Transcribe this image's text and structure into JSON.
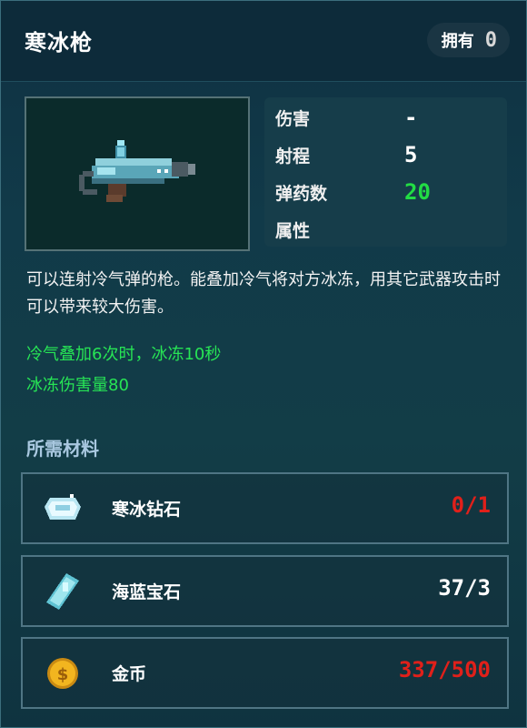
{
  "header": {
    "title": "寒冰枪",
    "owned_label": "拥有",
    "owned_count": "0"
  },
  "weapon": {
    "icon": "ice-gun-icon"
  },
  "stats": {
    "damage_label": "伤害",
    "damage_value": "-",
    "range_label": "射程",
    "range_value": "5",
    "ammo_label": "弹药数",
    "ammo_value": "20",
    "attribute_label": "属性",
    "ammo_color": "#22dd44"
  },
  "description": "可以连射冷气弹的枪。能叠加冷气将对方冰冻，用其它武器攻击时可以带来较大伤害。",
  "effects": [
    "冷气叠加6次时，冰冻10秒",
    "冰冻伤害量80"
  ],
  "materials_title": "所需材料",
  "materials": [
    {
      "name": "寒冰钻石",
      "amount": "0/1",
      "icon": "ice-diamond-icon",
      "amount_color": "#e0201a"
    },
    {
      "name": "海蓝宝石",
      "amount": "37/3",
      "icon": "aquamarine-icon",
      "amount_color": "#ffffff"
    },
    {
      "name": "金币",
      "amount": "337/500",
      "icon": "gold-coin-icon",
      "amount_color": "#e0201a"
    }
  ]
}
